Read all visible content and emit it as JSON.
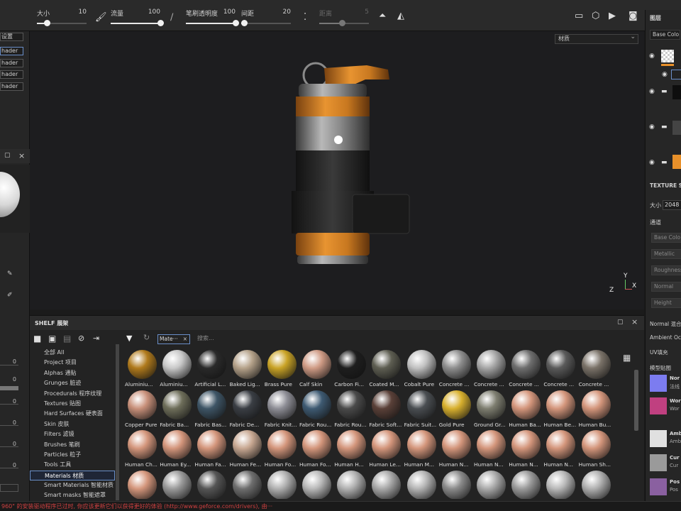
{
  "toolbar": {
    "size_label": "大小",
    "size_value": "10",
    "size_fill": 0.2,
    "flow_label": "流量",
    "flow_value": "100",
    "flow_fill": 1.0,
    "opacity_label": "笔刷透明度",
    "opacity_value": "100",
    "opacity_fill": 1.0,
    "spacing_label": "间距",
    "spacing_value": "20",
    "spacing_fill": 0.05,
    "distance_label": "距离",
    "distance_value": "5",
    "distance_fill": 0.45
  },
  "left": {
    "title_select": "设置",
    "shader_1": "hader",
    "shader_2": "hader",
    "shader_3": "hader",
    "shader_4": "hader",
    "numbers": [
      "0",
      "0",
      "0",
      "0",
      "0",
      "0"
    ]
  },
  "viewport": {
    "mode_select": "材质",
    "axis_x": "X",
    "axis_y": "Y",
    "axis_z": "Z"
  },
  "shelf": {
    "title": "SHELF 展架",
    "filter_tag": "Mate···",
    "search_placeholder": "搜索...",
    "categories": [
      "全部 All",
      "Project 项目",
      "Alphas 通贴",
      "Grunges 脏迹",
      "Procedurals 程序纹理",
      "Textures 贴图",
      "Hard Surfaces 硬表面",
      "Skin 皮肤",
      "Filters 滤镜",
      "Brushes 笔刷",
      "Particles 粒子",
      "Tools 工具",
      "Materials 材质",
      "Smart Materials 智能材质",
      "Smart masks 智能遮罩"
    ],
    "selected_category": 12,
    "materials": [
      {
        "label": "Aluminiu...",
        "color": "#b07a1c"
      },
      {
        "label": "Aluminiu...",
        "color": "#c8c8c8"
      },
      {
        "label": "Artificial L...",
        "color": "#2a2a2a"
      },
      {
        "label": "Baked Lig...",
        "color": "#b5a28a"
      },
      {
        "label": "Brass Pure",
        "color": "#c9a326"
      },
      {
        "label": "Calf Skin",
        "color": "#cf9b85"
      },
      {
        "label": "Carbon Fi...",
        "color": "#1e1e1e"
      },
      {
        "label": "Coated M...",
        "color": "#5e5e52"
      },
      {
        "label": "Cobalt Pure",
        "color": "#c0c0c0"
      },
      {
        "label": "Concrete ...",
        "color": "#8e8e8e"
      },
      {
        "label": "Concrete ...",
        "color": "#a6a6a6"
      },
      {
        "label": "Concrete ...",
        "color": "#6e6e6e"
      },
      {
        "label": "Concrete ...",
        "color": "#5a5a5a"
      },
      {
        "label": "Concrete ...",
        "color": "#7a7268"
      },
      {
        "label": "Copper Pure",
        "color": "#c8907a"
      },
      {
        "label": "Fabric Ba...",
        "color": "#6e6e5a"
      },
      {
        "label": "Fabric Bas...",
        "color": "#3e5566"
      },
      {
        "label": "Fabric De...",
        "color": "#3a3e44"
      },
      {
        "label": "Fabric Knit...",
        "color": "#8e8e96"
      },
      {
        "label": "Fabric Rou...",
        "color": "#3e5a72"
      },
      {
        "label": "Fabric Rou...",
        "color": "#4a4a4a"
      },
      {
        "label": "Fabric Soft...",
        "color": "#5a4038"
      },
      {
        "label": "Fabric Suit...",
        "color": "#4a4e52"
      },
      {
        "label": "Gold Pure",
        "color": "#d8b02e"
      },
      {
        "label": "Ground Gr...",
        "color": "#7e7e70"
      },
      {
        "label": "Human Ba...",
        "color": "#d4967c"
      },
      {
        "label": "Human Be...",
        "color": "#d4967c"
      },
      {
        "label": "Human Bu...",
        "color": "#d4967c"
      },
      {
        "label": "Human Ch...",
        "color": "#d4967c"
      },
      {
        "label": "Human Ey...",
        "color": "#d4967c"
      },
      {
        "label": "Human Fa...",
        "color": "#d4967c"
      },
      {
        "label": "Human Fe...",
        "color": "#c8a892"
      },
      {
        "label": "Human Fo...",
        "color": "#d4967c"
      },
      {
        "label": "Human Fo...",
        "color": "#d4967c"
      },
      {
        "label": "Human H...",
        "color": "#d4967c"
      },
      {
        "label": "Human Le...",
        "color": "#d4967c"
      },
      {
        "label": "Human M...",
        "color": "#d4967c"
      },
      {
        "label": "Human N...",
        "color": "#d4967c"
      },
      {
        "label": "Human N...",
        "color": "#d4967c"
      },
      {
        "label": "Human N...",
        "color": "#d4967c"
      },
      {
        "label": "Human N...",
        "color": "#d4967c"
      },
      {
        "label": "Human Sh...",
        "color": "#d4967c"
      },
      {
        "label": "",
        "color": "#d4967c"
      },
      {
        "label": "",
        "color": "#9a9a9a"
      },
      {
        "label": "",
        "color": "#555555"
      },
      {
        "label": "",
        "color": "#6e6e6e"
      },
      {
        "label": "",
        "color": "#b0b0b0"
      },
      {
        "label": "",
        "color": "#b8b8b8"
      },
      {
        "label": "",
        "color": "#b0b0b0"
      },
      {
        "label": "",
        "color": "#a8a8a8"
      },
      {
        "label": "",
        "color": "#b4b4b4"
      },
      {
        "label": "",
        "color": "#8a8a8a"
      },
      {
        "label": "",
        "color": "#aaaaaa"
      },
      {
        "label": "",
        "color": "#9a9a9a"
      },
      {
        "label": "",
        "color": "#b8b8b8"
      },
      {
        "label": "",
        "color": "#b0b0b0"
      }
    ]
  },
  "right": {
    "layers_title": "图层",
    "base_color": "Base Colo",
    "texture_title": "TEXTURE S",
    "size_label": "大小",
    "size_value": "2048",
    "channels_label": "通道",
    "ch_base": "Base Colo",
    "ch_metal": "Metallic",
    "ch_rough": "Roughness",
    "ch_normal": "Normal",
    "ch_height": "Height",
    "normal_mix": "Normal 混合",
    "ambient": "Ambient Oc",
    "uv_fill": "UV填充",
    "model_map": "模型贴图",
    "maps": [
      {
        "a": "Nor",
        "b": "法线"
      },
      {
        "a": "Wor",
        "b": "Wor"
      },
      {
        "a": "Amb",
        "b": "Amb"
      },
      {
        "a": "Cur",
        "b": "Cur"
      },
      {
        "a": "Pos",
        "b": "Pos"
      }
    ]
  },
  "status": {
    "text": "960\" 的安装驱动程序已过时, 你应该更新它们以获得更好的体验 (http://www.geforce.com/drivers), 由···"
  }
}
